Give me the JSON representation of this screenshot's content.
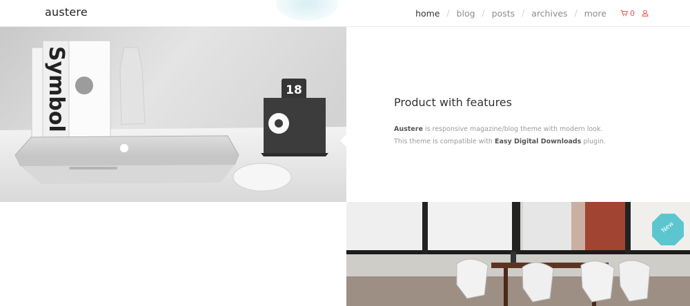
{
  "header": {
    "logo": "austere",
    "nav": [
      {
        "label": "home",
        "active": true
      },
      {
        "label": "blog",
        "active": false
      },
      {
        "label": "posts",
        "active": false
      },
      {
        "label": "archives",
        "active": false
      },
      {
        "label": "more",
        "active": false
      }
    ],
    "nav_separator": "/",
    "cart_count": "0",
    "icons": {
      "cart": "cart-icon",
      "user": "user-icon"
    }
  },
  "hero": {
    "book_title": "Symbol",
    "calendar_date": "18"
  },
  "feature": {
    "title": "Product with features",
    "desc_line1_bold": "Austere",
    "desc_line1_rest": " is responsive magazine/blog theme with modern look.",
    "desc_line2_start": "This theme is compatible with ",
    "desc_line2_bold": "Easy Digital Downloads",
    "desc_line2_end": " plugin."
  },
  "badge": {
    "label": "New"
  },
  "colors": {
    "accent": "#e15a4e",
    "badge": "#5cc6cf"
  }
}
